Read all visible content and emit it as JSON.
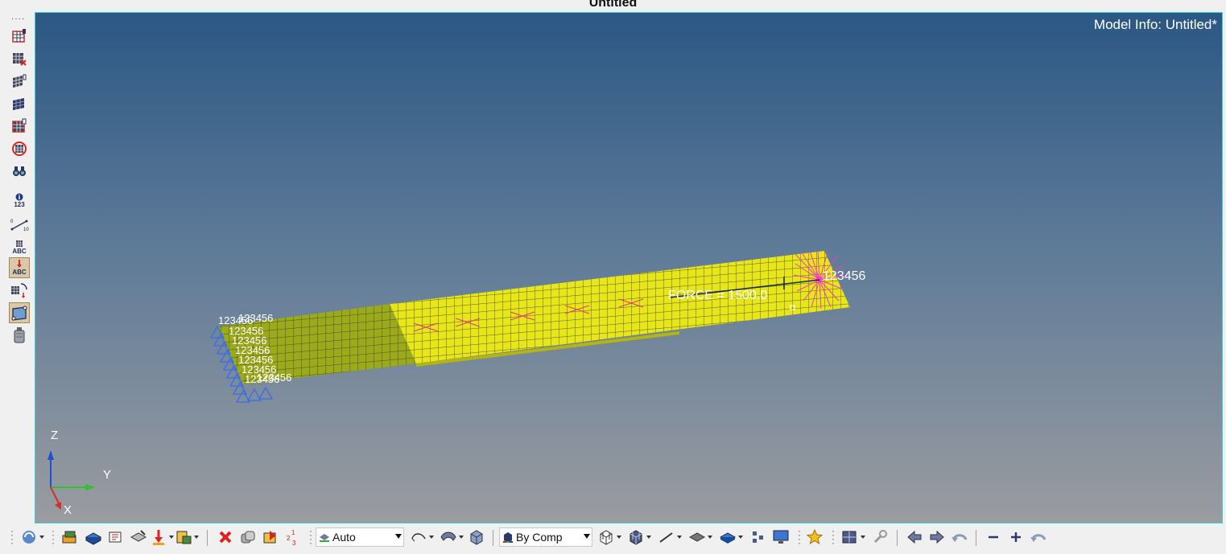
{
  "window": {
    "title": "Untitled"
  },
  "viewport": {
    "model_info": "Model Info: Untitled*",
    "force_label": "FORCE = 1500.0",
    "constraint_label": "123456",
    "clamp_label": "123456",
    "axes": {
      "z": "Z",
      "y": "Y",
      "x": "X"
    },
    "colors": {
      "yellow_plate": "#e6e619",
      "olive_plate": "#9aaa1a",
      "constraint": "#3a6ee6",
      "rbe": "#ff33cc"
    }
  },
  "left_toolbar": {
    "items": [
      {
        "icon": "mesh-edit-icon"
      },
      {
        "icon": "mesh-delete-icon"
      },
      {
        "icon": "mesh-shell-icon"
      },
      {
        "icon": "mesh-solid-icon"
      },
      {
        "icon": "mesh-check-icon"
      },
      {
        "icon": "mesh-target-icon"
      },
      {
        "icon": "binoculars-icon"
      },
      {
        "icon": "info-icon",
        "label": "123"
      },
      {
        "icon": "measure-icon"
      },
      {
        "icon": "label-icon",
        "label": "ABC"
      },
      {
        "icon": "load-label-icon",
        "label": "ABC",
        "active": true
      },
      {
        "icon": "move-icon"
      },
      {
        "icon": "panel-icon",
        "active": true
      },
      {
        "icon": "weight-icon"
      }
    ]
  },
  "bottom_toolbar": {
    "display_mode": "Auto",
    "color_mode": "By Comp"
  }
}
